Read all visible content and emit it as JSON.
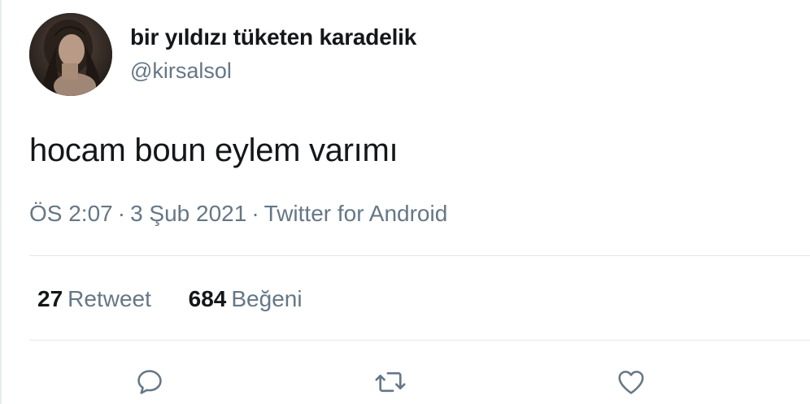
{
  "user": {
    "display_name": "bir yıldızı tüketen karadelik",
    "handle": "@kirsalsol"
  },
  "tweet": {
    "text": "hocam boun eylem varımı",
    "time": "ÖS 2:07",
    "date": "3 Şub 2021",
    "source": "Twitter for Android",
    "separator": "·"
  },
  "stats": {
    "retweets_count": "27",
    "retweets_label": "Retweet",
    "likes_count": "684",
    "likes_label": "Beğeni"
  },
  "actions": {
    "reply_icon": "reply-icon",
    "retweet_icon": "retweet-icon",
    "like_icon": "heart-icon"
  },
  "colors": {
    "text": "#14171a",
    "secondary": "#657786",
    "divider": "#e1e8ed"
  }
}
